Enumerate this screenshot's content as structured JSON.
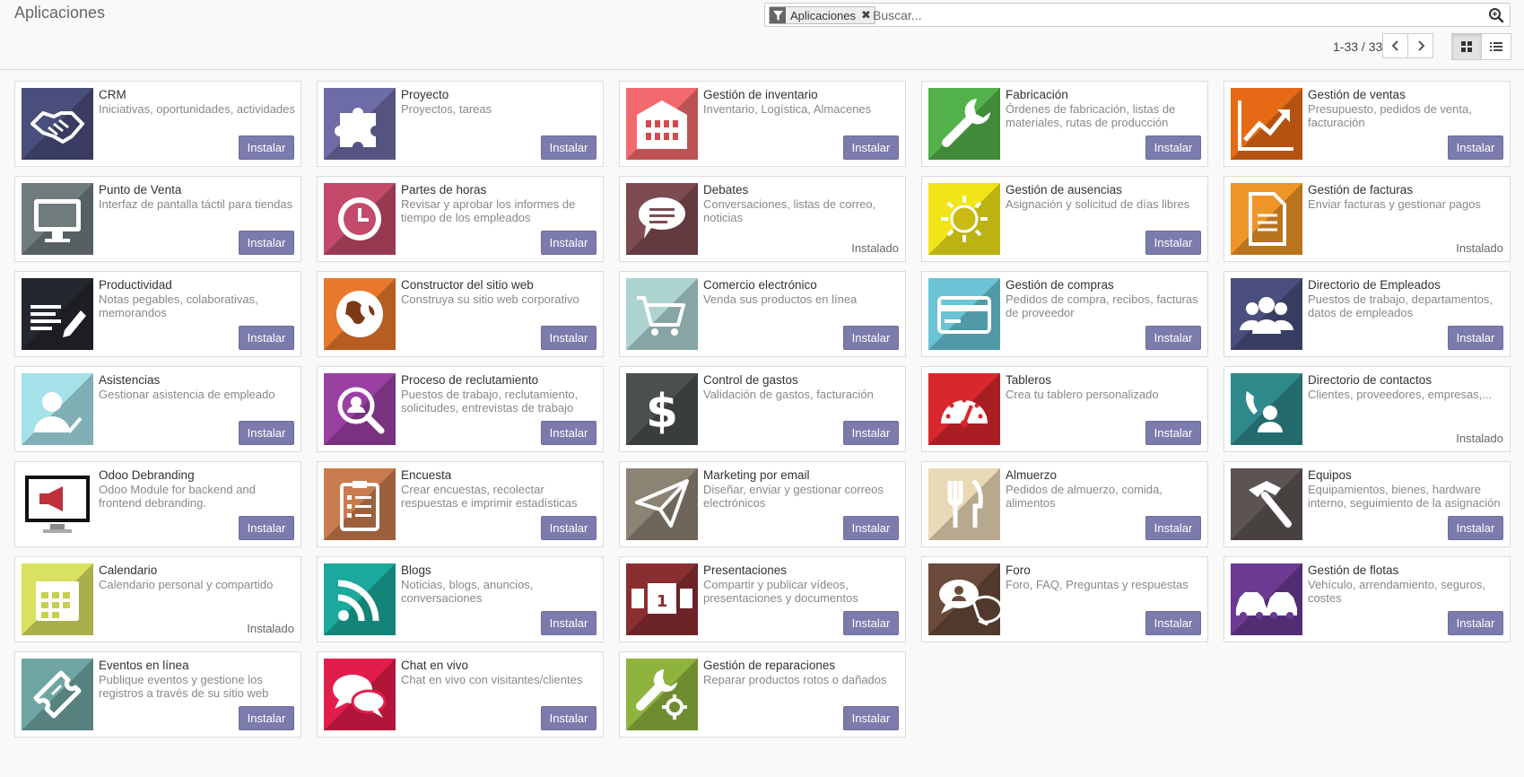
{
  "header": {
    "breadcrumb": "Aplicaciones",
    "facet_label": "Aplicaciones",
    "search_placeholder": "Buscar...",
    "pager_value": "1-33 / 33"
  },
  "apps": [
    {
      "name": "CRM",
      "summary": "Iniciativas, oportunidades, actividades",
      "action": "Instalar",
      "installed": false,
      "color": "#4a4e7c",
      "icon": "handshake-icon"
    },
    {
      "name": "Proyecto",
      "summary": "Proyectos, tareas",
      "action": "Instalar",
      "installed": false,
      "color": "#6e6ca6",
      "icon": "puzzle-icon"
    },
    {
      "name": "Gestión de inventario",
      "summary": "Inventario, Logística, Almacenes",
      "action": "Instalar",
      "installed": false,
      "color": "#f36a6e",
      "icon": "warehouse-icon"
    },
    {
      "name": "Fabricación",
      "summary": "Órdenes de fabricación, listas de materiales, rutas de producción",
      "action": "Instalar",
      "installed": false,
      "color": "#53b14a",
      "icon": "wrench-icon"
    },
    {
      "name": "Gestión de ventas",
      "summary": "Presupuesto, pedidos de venta, facturación",
      "action": "Instalar",
      "installed": false,
      "color": "#e66a16",
      "icon": "chart-line-icon"
    },
    {
      "name": "Punto de Venta",
      "summary": "Interfaz de pantalla táctil para tiendas",
      "action": "Instalar",
      "installed": false,
      "color": "#6f7b7d",
      "icon": "monitor-icon"
    },
    {
      "name": "Partes de horas",
      "summary": "Revisar y aprobar los informes de tiempo de los empleados",
      "action": "Instalar",
      "installed": false,
      "color": "#c34a6a",
      "icon": "clock-icon"
    },
    {
      "name": "Debates",
      "summary": "Conversaciones, listas de correo, noticias",
      "action": "Instalado",
      "installed": true,
      "color": "#7e4b52",
      "icon": "speech-bubble-icon"
    },
    {
      "name": "Gestión de ausencias",
      "summary": "Asignación y solicitud de días libres",
      "action": "Instalar",
      "installed": false,
      "color": "#f1e417",
      "icon": "sun-icon"
    },
    {
      "name": "Gestión de facturas",
      "summary": "Enviar facturas y gestionar pagos",
      "action": "Instalado",
      "installed": true,
      "color": "#ee9528",
      "icon": "document-icon"
    },
    {
      "name": "Productividad",
      "summary": "Notas pegables, colaborativas, memorandos",
      "action": "Instalar",
      "installed": false,
      "color": "#25272e",
      "icon": "notes-pencil-icon"
    },
    {
      "name": "Constructor del sitio web",
      "summary": "Construya su sitio web corporativo",
      "action": "Instalar",
      "installed": false,
      "color": "#e9782c",
      "icon": "globe-icon"
    },
    {
      "name": "Comercio electrónico",
      "summary": "Venda sus productos en línea",
      "action": "Instalar",
      "installed": false,
      "color": "#aed4d2",
      "icon": "cart-icon"
    },
    {
      "name": "Gestión de compras",
      "summary": "Pedidos de compra, recibos, facturas de proveedor",
      "action": "Instalar",
      "installed": false,
      "color": "#6ac4d6",
      "icon": "credit-card-icon"
    },
    {
      "name": "Directorio de Empleados",
      "summary": "Puestos de trabajo, departamentos, datos de empleados",
      "action": "Instalar",
      "installed": false,
      "color": "#4b4f7e",
      "icon": "users-icon"
    },
    {
      "name": "Asistencias",
      "summary": "Gestionar asistencia de empleado",
      "action": "Instalar",
      "installed": false,
      "color": "#a4e1e9",
      "icon": "user-check-icon"
    },
    {
      "name": "Proceso de reclutamiento",
      "summary": "Puestos de trabajo, reclutamiento, solicitudes, entrevistas de trabajo",
      "action": "Instalar",
      "installed": false,
      "color": "#9a40a3",
      "icon": "search-user-icon"
    },
    {
      "name": "Control de gastos",
      "summary": "Validación de gastos, facturación",
      "action": "Instalar",
      "installed": false,
      "color": "#4b4f4f",
      "icon": "dollar-icon"
    },
    {
      "name": "Tableros",
      "summary": "Crea tu tablero personalizado",
      "action": "Instalar",
      "installed": false,
      "color": "#d8272d",
      "icon": "gauge-icon"
    },
    {
      "name": "Directorio de contactos",
      "summary": "Clientes, proveedores, empresas,...",
      "action": "Instalado",
      "installed": true,
      "color": "#2f8a8c",
      "icon": "contact-phone-icon"
    },
    {
      "name": "Odoo Debranding",
      "summary": "Odoo Module for backend and frontend debranding.",
      "action": "Instalar",
      "installed": false,
      "color": "#ffffff",
      "icon": "megaphone-monitor-icon"
    },
    {
      "name": "Encuesta",
      "summary": "Crear encuestas, recolectar respuestas e imprimir estadísticas",
      "action": "Instalar",
      "installed": false,
      "color": "#c97c4f",
      "icon": "clipboard-icon"
    },
    {
      "name": "Marketing por email",
      "summary": "Diseñar, enviar y gestionar correos electrónicos",
      "action": "Instalar",
      "installed": false,
      "color": "#8d8374",
      "icon": "paper-plane-icon"
    },
    {
      "name": "Almuerzo",
      "summary": "Pedidos de almuerzo, comida, alimentos",
      "action": "Instalar",
      "installed": false,
      "color": "#e9d9b6",
      "icon": "cutlery-icon"
    },
    {
      "name": "Equipos",
      "summary": "Equipamientos, bienes, hardware interno, seguimiento de la asignación",
      "action": "Instalar",
      "installed": false,
      "color": "#5b5452",
      "icon": "hammer-icon"
    },
    {
      "name": "Calendario",
      "summary": "Calendario personal y compartido",
      "action": "Instalado",
      "installed": true,
      "color": "#d8e160",
      "icon": "calendar-icon"
    },
    {
      "name": "Blogs",
      "summary": "Noticias, blogs, anuncios, conversaciones",
      "action": "Instalar",
      "installed": false,
      "color": "#1aa99c",
      "icon": "rss-icon"
    },
    {
      "name": "Presentaciones",
      "summary": "Compartir y publicar vídeos, presentaciones y documentos",
      "action": "Instalar",
      "installed": false,
      "color": "#8a2e32",
      "icon": "slides-icon"
    },
    {
      "name": "Foro",
      "summary": "Foro, FAQ, Preguntas y respuestas",
      "action": "Instalar",
      "installed": false,
      "color": "#6a4a3a",
      "icon": "forum-bubbles-icon"
    },
    {
      "name": "Gestión de flotas",
      "summary": "Vehículo, arrendamiento, seguros, costes",
      "action": "Instalar",
      "installed": false,
      "color": "#6b3a92",
      "icon": "cars-icon"
    },
    {
      "name": "Eventos en línea",
      "summary": "Publique eventos y gestione los registros a través de su sitio web",
      "action": "Instalar",
      "installed": false,
      "color": "#6fa6a3",
      "icon": "ticket-icon"
    },
    {
      "name": "Chat en vivo",
      "summary": "Chat en vivo con visitantes/clientes",
      "action": "Instalar",
      "installed": false,
      "color": "#e31d4b",
      "icon": "chat-bubbles-icon"
    },
    {
      "name": "Gestión de reparaciones",
      "summary": "Reparar productos rotos o dañados",
      "action": "Instalar",
      "installed": false,
      "color": "#8fb43e",
      "icon": "repair-wrench-icon"
    }
  ]
}
